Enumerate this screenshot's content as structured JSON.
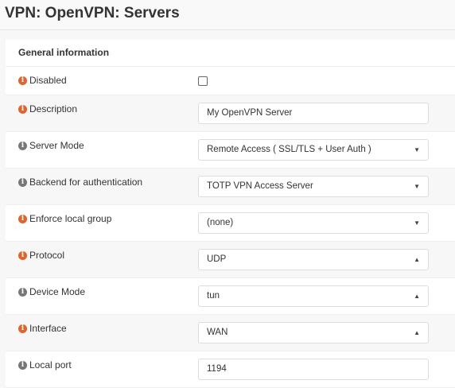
{
  "title": "VPN: OpenVPN: Servers",
  "section": "General information",
  "colors": {
    "required_icon": "#e5622a",
    "info_icon": "#777777"
  },
  "fields": [
    {
      "label": "Disabled",
      "type": "checkbox",
      "checked": false,
      "icon": "info-required"
    },
    {
      "label": "Description",
      "type": "text",
      "value": "My OpenVPN Server",
      "icon": "info-required"
    },
    {
      "label": "Server Mode",
      "type": "select",
      "value": "Remote Access ( SSL/TLS + User Auth )",
      "caret": "▼",
      "icon": "info"
    },
    {
      "label": "Backend for authentication",
      "type": "select",
      "value": "TOTP VPN Access Server",
      "caret": "▼",
      "icon": "info"
    },
    {
      "label": "Enforce local group",
      "type": "select",
      "value": "(none)",
      "caret": "▼",
      "icon": "info-required"
    },
    {
      "label": "Protocol",
      "type": "select",
      "value": "UDP",
      "caret": "▲",
      "icon": "info-required"
    },
    {
      "label": "Device Mode",
      "type": "select",
      "value": "tun",
      "caret": "▲",
      "icon": "info"
    },
    {
      "label": "Interface",
      "type": "select",
      "value": "WAN",
      "caret": "▲",
      "icon": "info-required"
    },
    {
      "label": "Local port",
      "type": "text",
      "value": "1194",
      "icon": "info"
    }
  ]
}
